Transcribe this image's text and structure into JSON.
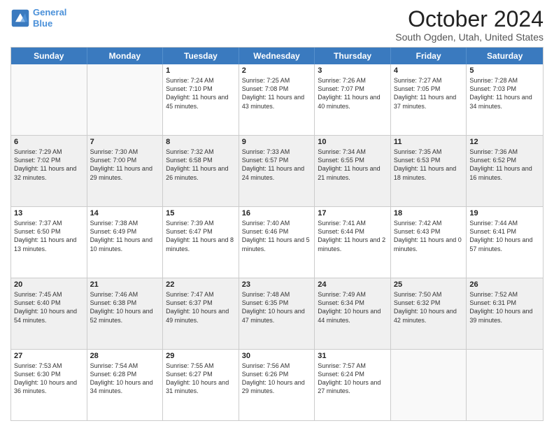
{
  "header": {
    "logo_line1": "General",
    "logo_line2": "Blue",
    "title": "October 2024",
    "subtitle": "South Ogden, Utah, United States"
  },
  "days_of_week": [
    "Sunday",
    "Monday",
    "Tuesday",
    "Wednesday",
    "Thursday",
    "Friday",
    "Saturday"
  ],
  "weeks": [
    [
      {
        "day": "",
        "sunrise": "",
        "sunset": "",
        "daylight": "",
        "shaded": false
      },
      {
        "day": "",
        "sunrise": "",
        "sunset": "",
        "daylight": "",
        "shaded": false
      },
      {
        "day": "1",
        "sunrise": "Sunrise: 7:24 AM",
        "sunset": "Sunset: 7:10 PM",
        "daylight": "Daylight: 11 hours and 45 minutes.",
        "shaded": false
      },
      {
        "day": "2",
        "sunrise": "Sunrise: 7:25 AM",
        "sunset": "Sunset: 7:08 PM",
        "daylight": "Daylight: 11 hours and 43 minutes.",
        "shaded": false
      },
      {
        "day": "3",
        "sunrise": "Sunrise: 7:26 AM",
        "sunset": "Sunset: 7:07 PM",
        "daylight": "Daylight: 11 hours and 40 minutes.",
        "shaded": false
      },
      {
        "day": "4",
        "sunrise": "Sunrise: 7:27 AM",
        "sunset": "Sunset: 7:05 PM",
        "daylight": "Daylight: 11 hours and 37 minutes.",
        "shaded": false
      },
      {
        "day": "5",
        "sunrise": "Sunrise: 7:28 AM",
        "sunset": "Sunset: 7:03 PM",
        "daylight": "Daylight: 11 hours and 34 minutes.",
        "shaded": false
      }
    ],
    [
      {
        "day": "6",
        "sunrise": "Sunrise: 7:29 AM",
        "sunset": "Sunset: 7:02 PM",
        "daylight": "Daylight: 11 hours and 32 minutes.",
        "shaded": true
      },
      {
        "day": "7",
        "sunrise": "Sunrise: 7:30 AM",
        "sunset": "Sunset: 7:00 PM",
        "daylight": "Daylight: 11 hours and 29 minutes.",
        "shaded": true
      },
      {
        "day": "8",
        "sunrise": "Sunrise: 7:32 AM",
        "sunset": "Sunset: 6:58 PM",
        "daylight": "Daylight: 11 hours and 26 minutes.",
        "shaded": true
      },
      {
        "day": "9",
        "sunrise": "Sunrise: 7:33 AM",
        "sunset": "Sunset: 6:57 PM",
        "daylight": "Daylight: 11 hours and 24 minutes.",
        "shaded": true
      },
      {
        "day": "10",
        "sunrise": "Sunrise: 7:34 AM",
        "sunset": "Sunset: 6:55 PM",
        "daylight": "Daylight: 11 hours and 21 minutes.",
        "shaded": true
      },
      {
        "day": "11",
        "sunrise": "Sunrise: 7:35 AM",
        "sunset": "Sunset: 6:53 PM",
        "daylight": "Daylight: 11 hours and 18 minutes.",
        "shaded": true
      },
      {
        "day": "12",
        "sunrise": "Sunrise: 7:36 AM",
        "sunset": "Sunset: 6:52 PM",
        "daylight": "Daylight: 11 hours and 16 minutes.",
        "shaded": true
      }
    ],
    [
      {
        "day": "13",
        "sunrise": "Sunrise: 7:37 AM",
        "sunset": "Sunset: 6:50 PM",
        "daylight": "Daylight: 11 hours and 13 minutes.",
        "shaded": false
      },
      {
        "day": "14",
        "sunrise": "Sunrise: 7:38 AM",
        "sunset": "Sunset: 6:49 PM",
        "daylight": "Daylight: 11 hours and 10 minutes.",
        "shaded": false
      },
      {
        "day": "15",
        "sunrise": "Sunrise: 7:39 AM",
        "sunset": "Sunset: 6:47 PM",
        "daylight": "Daylight: 11 hours and 8 minutes.",
        "shaded": false
      },
      {
        "day": "16",
        "sunrise": "Sunrise: 7:40 AM",
        "sunset": "Sunset: 6:46 PM",
        "daylight": "Daylight: 11 hours and 5 minutes.",
        "shaded": false
      },
      {
        "day": "17",
        "sunrise": "Sunrise: 7:41 AM",
        "sunset": "Sunset: 6:44 PM",
        "daylight": "Daylight: 11 hours and 2 minutes.",
        "shaded": false
      },
      {
        "day": "18",
        "sunrise": "Sunrise: 7:42 AM",
        "sunset": "Sunset: 6:43 PM",
        "daylight": "Daylight: 11 hours and 0 minutes.",
        "shaded": false
      },
      {
        "day": "19",
        "sunrise": "Sunrise: 7:44 AM",
        "sunset": "Sunset: 6:41 PM",
        "daylight": "Daylight: 10 hours and 57 minutes.",
        "shaded": false
      }
    ],
    [
      {
        "day": "20",
        "sunrise": "Sunrise: 7:45 AM",
        "sunset": "Sunset: 6:40 PM",
        "daylight": "Daylight: 10 hours and 54 minutes.",
        "shaded": true
      },
      {
        "day": "21",
        "sunrise": "Sunrise: 7:46 AM",
        "sunset": "Sunset: 6:38 PM",
        "daylight": "Daylight: 10 hours and 52 minutes.",
        "shaded": true
      },
      {
        "day": "22",
        "sunrise": "Sunrise: 7:47 AM",
        "sunset": "Sunset: 6:37 PM",
        "daylight": "Daylight: 10 hours and 49 minutes.",
        "shaded": true
      },
      {
        "day": "23",
        "sunrise": "Sunrise: 7:48 AM",
        "sunset": "Sunset: 6:35 PM",
        "daylight": "Daylight: 10 hours and 47 minutes.",
        "shaded": true
      },
      {
        "day": "24",
        "sunrise": "Sunrise: 7:49 AM",
        "sunset": "Sunset: 6:34 PM",
        "daylight": "Daylight: 10 hours and 44 minutes.",
        "shaded": true
      },
      {
        "day": "25",
        "sunrise": "Sunrise: 7:50 AM",
        "sunset": "Sunset: 6:32 PM",
        "daylight": "Daylight: 10 hours and 42 minutes.",
        "shaded": true
      },
      {
        "day": "26",
        "sunrise": "Sunrise: 7:52 AM",
        "sunset": "Sunset: 6:31 PM",
        "daylight": "Daylight: 10 hours and 39 minutes.",
        "shaded": true
      }
    ],
    [
      {
        "day": "27",
        "sunrise": "Sunrise: 7:53 AM",
        "sunset": "Sunset: 6:30 PM",
        "daylight": "Daylight: 10 hours and 36 minutes.",
        "shaded": false
      },
      {
        "day": "28",
        "sunrise": "Sunrise: 7:54 AM",
        "sunset": "Sunset: 6:28 PM",
        "daylight": "Daylight: 10 hours and 34 minutes.",
        "shaded": false
      },
      {
        "day": "29",
        "sunrise": "Sunrise: 7:55 AM",
        "sunset": "Sunset: 6:27 PM",
        "daylight": "Daylight: 10 hours and 31 minutes.",
        "shaded": false
      },
      {
        "day": "30",
        "sunrise": "Sunrise: 7:56 AM",
        "sunset": "Sunset: 6:26 PM",
        "daylight": "Daylight: 10 hours and 29 minutes.",
        "shaded": false
      },
      {
        "day": "31",
        "sunrise": "Sunrise: 7:57 AM",
        "sunset": "Sunset: 6:24 PM",
        "daylight": "Daylight: 10 hours and 27 minutes.",
        "shaded": false
      },
      {
        "day": "",
        "sunrise": "",
        "sunset": "",
        "daylight": "",
        "shaded": false
      },
      {
        "day": "",
        "sunrise": "",
        "sunset": "",
        "daylight": "",
        "shaded": false
      }
    ]
  ]
}
